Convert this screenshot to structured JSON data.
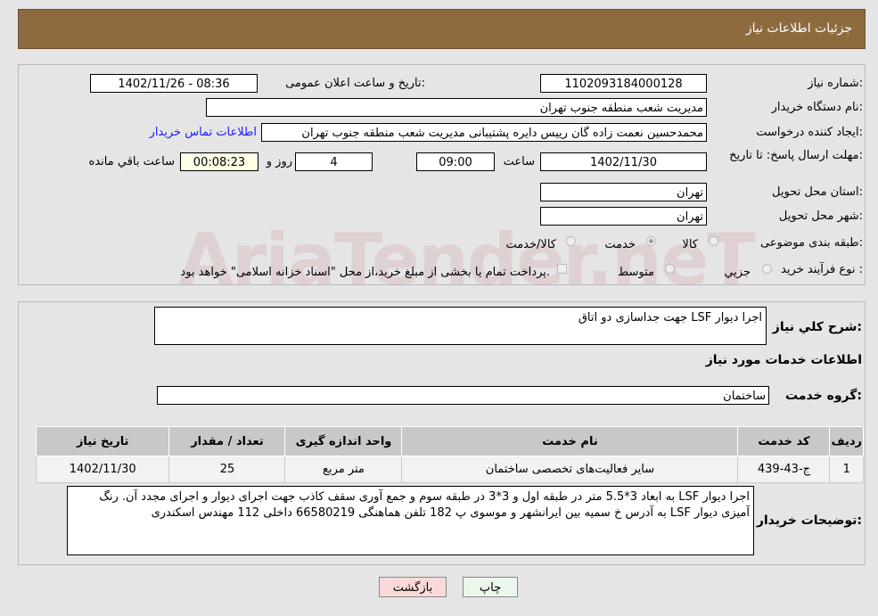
{
  "header": {
    "title": "جزئیات اطلاعات نیاز"
  },
  "watermark": "AriaTender.neT",
  "form": {
    "need_number_label": "شماره نیاز:",
    "need_number": "1102093184000128",
    "announce_label": "تاریخ و ساعت اعلان عمومی:",
    "announce_value": "1402/11/26 - 08:36",
    "buyer_org_label": "نام دستگاه خریدار:",
    "buyer_org": "مدیریت شعب منطقه جنوب تهران",
    "creator_label": "ایجاد کننده درخواست:",
    "creator": "محمدحسین نعمت زاده گان رییس دایره پشتیبانی مدیریت شعب منطقه جنوب تهران",
    "contact_link": "اطلاعات تماس خریدار",
    "deadline_label": "مهلت ارسال پاسخ: تا تاریخ:",
    "deadline_date": "1402/11/30",
    "time_label": "ساعت",
    "deadline_time": "09:00",
    "days": "4",
    "days_label": "روز و",
    "remaining": "00:08:23",
    "remaining_label": "ساعت باقي مانده",
    "province_label": "استان محل تحویل:",
    "province": "تهران",
    "city_label": "شهر محل تحویل:",
    "city": "تهران",
    "category_label": "طبقه بندی موضوعی:",
    "category_options": [
      "کالا",
      "خدمت",
      "کالا/خدمت"
    ],
    "category_selected": "خدمت",
    "process_label": "نوع فرآیند خرید :",
    "process_options": [
      "جزيي",
      "متوسط"
    ],
    "payment_note": "پرداخت تمام یا بخشی از مبلغ خرید،از محل \"اسناد خزانه اسلامی\" خواهد بود."
  },
  "details": {
    "summary_label": "شرح کلي نياز:",
    "summary": "اجرا دیوار LSF جهت جداسازی دو اتاق",
    "services_title": "اطلاعات خدمات مورد نیاز",
    "group_label": "گروه خدمت:",
    "group": "ساختمان",
    "table": {
      "headers": [
        "ردیف",
        "کد خدمت",
        "نام خدمت",
        "واحد اندازه گیری",
        "تعداد / مقدار",
        "تاریخ نیاز"
      ],
      "rows": [
        [
          "1",
          "ج-43-439",
          "سایر فعالیت‌های تخصصی ساختمان",
          "متر مربع",
          "25",
          "1402/11/30"
        ]
      ]
    },
    "buyer_notes_label": "توضیحات خریدار:",
    "buyer_notes": "اجرا دیوار LSF به ابعاد 3*5.5 متر در طبقه اول و 3*3 در طبقه سوم و جمع آوری سقف کاذب جهت اجرای دیوار و اجرای مجدد آن. رنگ آمیزی دیوار LSF به آدرس خ سمیه بین ایرانشهر و موسوی پ 182 تلفن هماهنگی 66580219 داخلی 112 مهندس اسکندری"
  },
  "buttons": {
    "print": "چاپ",
    "back": "بازگشت"
  }
}
